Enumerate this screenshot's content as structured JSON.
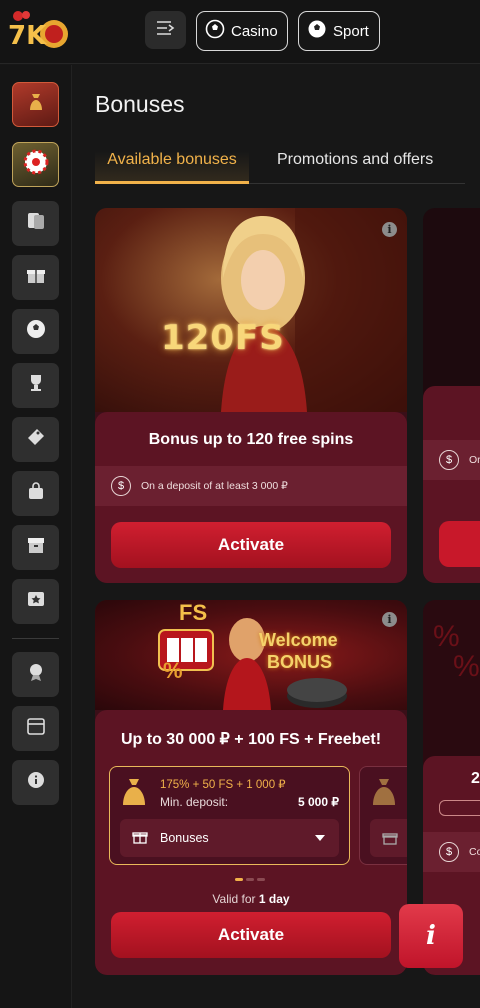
{
  "header": {
    "logo_text": "7K",
    "menu_icon": "menu-collapse-icon",
    "casino_label": "Casino",
    "sport_label": "Sport"
  },
  "sidebar": {
    "items": [
      {
        "icon": "money-bag-icon",
        "active": true
      },
      {
        "icon": "roulette-icon",
        "active": true
      },
      {
        "icon": "cards-icon"
      },
      {
        "icon": "gift-icon"
      },
      {
        "icon": "soccer-ball-icon"
      },
      {
        "icon": "trophy-icon"
      },
      {
        "icon": "ticket-icon"
      },
      {
        "icon": "shopping-bag-icon"
      },
      {
        "icon": "archive-icon"
      },
      {
        "icon": "star-box-icon"
      },
      {
        "icon": "award-icon"
      },
      {
        "icon": "calendar-icon"
      },
      {
        "icon": "info-icon"
      }
    ]
  },
  "page": {
    "title": "Bonuses",
    "tabs": [
      "Available bonuses",
      "Promotions and offers"
    ]
  },
  "card1": {
    "hero_text": "120FS",
    "title": "Bonus up to 120 free spins",
    "deposit_text": "On a deposit of at least 3 000 ₽",
    "button": "Activate"
  },
  "card2": {
    "hero_fs": "FS",
    "hero_welcome": "Welcome",
    "hero_bonus": "BONUS",
    "title": "Up to 30 000 ₽ + 100 FS + Freebet!",
    "option_amount": "175% + 50 FS + 1 000 ₽",
    "option_min_label": "Min. deposit:",
    "option_min_value": "5 000 ₽",
    "option_select": "Bonuses",
    "valid_prefix": "Valid for",
    "valid_value": "1 day",
    "button": "Activate"
  },
  "peek1": {
    "deposit_text": "Or"
  },
  "peek2": {
    "title_fragment": "2",
    "deposit_text": "Co"
  },
  "fab": {
    "icon": "info-icon",
    "label": "i"
  },
  "colors": {
    "accent": "#f1b24a",
    "button": "#c8182a",
    "panel": "#5c1423"
  }
}
